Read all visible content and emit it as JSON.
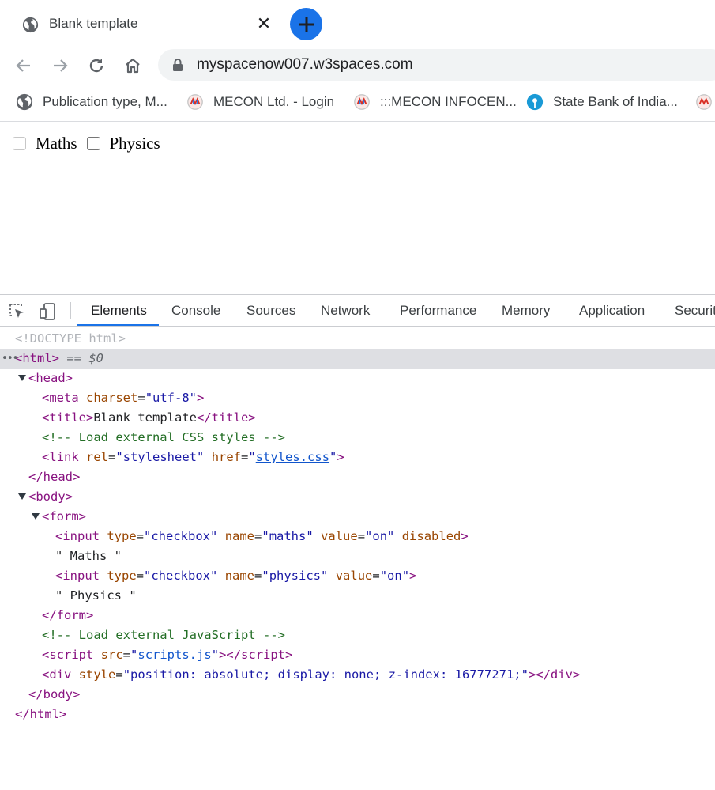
{
  "browser": {
    "tab": {
      "title": "Blank template",
      "icon": "globe-icon"
    },
    "url": "myspacenow007.w3spaces.com",
    "bookmarks": [
      {
        "label": "Publication type, M...",
        "icon": "globe-icon"
      },
      {
        "label": "MECON Ltd. - Login",
        "icon": "mecon-logo-icon"
      },
      {
        "label": ":::MECON INFOCEN...",
        "icon": "mecon-logo-icon"
      },
      {
        "label": "State Bank of India...",
        "icon": "sbi-logo-icon"
      }
    ]
  },
  "page": {
    "checkboxes": [
      {
        "label": "Maths",
        "disabled": true,
        "checked": false
      },
      {
        "label": "Physics",
        "disabled": false,
        "checked": false
      }
    ]
  },
  "devtools": {
    "tabs": [
      "Elements",
      "Console",
      "Sources",
      "Network",
      "Performance",
      "Memory",
      "Application",
      "Securit"
    ],
    "active_tab": "Elements",
    "dom": {
      "doctype": "<!DOCTYPE html>",
      "html_open": "<html>",
      "html_sel": " == $0",
      "head_open": "<head>",
      "meta_tag": "meta",
      "meta_attr": "charset",
      "meta_val": "\"utf-8\"",
      "title_text": "Blank template",
      "css_comment": "<!-- Load external CSS styles -->",
      "link_rel_val": "\"stylesheet\"",
      "link_href": "styles.css",
      "head_close": "</head>",
      "body_open": "<body>",
      "form_open": "<form>",
      "input1_name": "\"maths\"",
      "input1_value": "\"on\"",
      "input1_disabled": "disabled",
      "text1": "\" Maths \"",
      "input2_name": "\"physics\"",
      "input2_value": "\"on\"",
      "text2": "\" Physics \"",
      "form_close": "</form>",
      "js_comment": "<!-- Load external JavaScript -->",
      "script_src": "scripts.js",
      "div_style": "\"position: absolute; display: none; z-index: 16777271;\"",
      "body_close": "</body>",
      "html_close": "</html>"
    }
  }
}
